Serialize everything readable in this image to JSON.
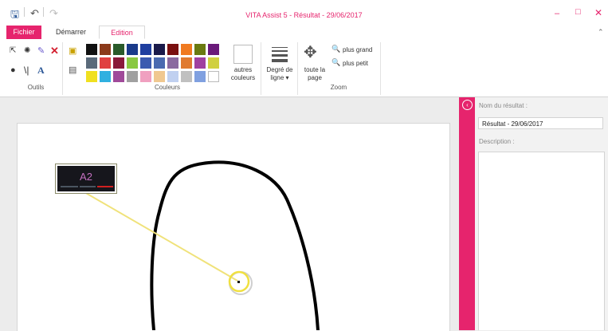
{
  "window": {
    "title": "VITA Assist 5 - Résultat - 29/06/2017",
    "accent": "#e6246d"
  },
  "quick_access": [
    "save-icon",
    "undo-icon",
    "redo-icon"
  ],
  "tabs": [
    {
      "label": "Fichier"
    },
    {
      "label": "Démarrer"
    },
    {
      "label": "Edition"
    }
  ],
  "ribbon": {
    "groups": {
      "outils": "Outils",
      "couleurs": "Couleurs",
      "zoom": "Zoom"
    },
    "palette": [
      [
        "#111111",
        "#8b3a1a",
        "#2a5a2a",
        "#1a3a8a",
        "#1f3fa0",
        "#1a1a4a",
        "#7a1010",
        "#f07a20",
        "#6a7a10",
        "#6a1a7a"
      ],
      [
        "#5a6a7a",
        "#e04040",
        "#8a1a3a",
        "#8ac840",
        "#3a5ab0",
        "#4a6ab0",
        "#8a6aa0",
        "#e07a30",
        "#a040a0",
        "#d0d040"
      ],
      [
        "#f0e020",
        "#30b0e0",
        "#a04a9a",
        "#a0a0a0",
        "#f0a0c0",
        "#f0c890",
        "#c0d0f0",
        "#c0c0c0",
        "#80a0e0",
        "#ffffff"
      ]
    ],
    "autres_couleurs": "autres couleurs",
    "degre_de_ligne": "Degré de ligne",
    "toute_la_page": "toute la page",
    "plus_grand": "plus grand",
    "plus_petit": "plus petit"
  },
  "canvas": {
    "label_text": "A2"
  },
  "panel": {
    "name_label": "Nom du résultat :",
    "name_value": "Résultat - 29/06/2017",
    "description_label": "Description :"
  }
}
